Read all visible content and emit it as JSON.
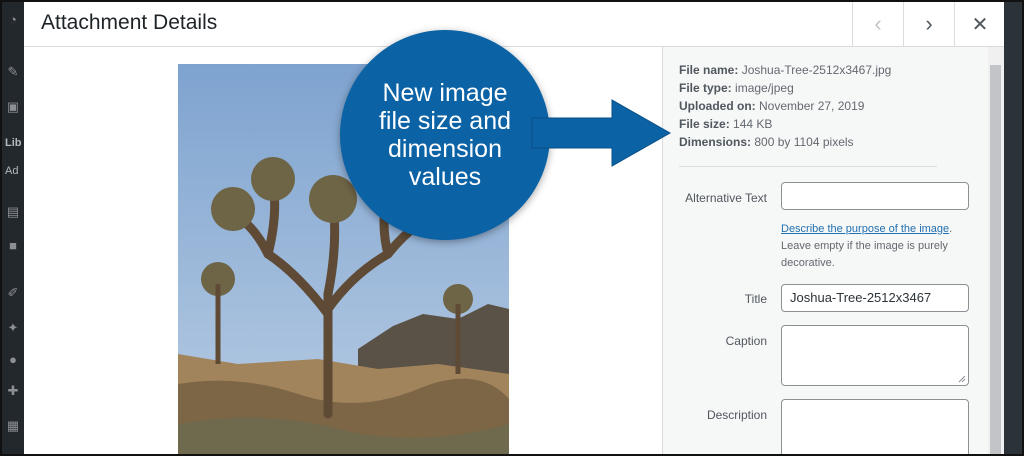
{
  "admin": {
    "lib_label": "Lib",
    "add_label": "Ad"
  },
  "header": {
    "title": "Attachment Details"
  },
  "file_info": {
    "name_label": "File name:",
    "name": "Joshua-Tree-2512x3467.jpg",
    "type_label": "File type:",
    "type": "image/jpeg",
    "uploaded_label": "Uploaded on:",
    "uploaded": "November 27, 2019",
    "size_label": "File size:",
    "size": "144 KB",
    "dimensions_label": "Dimensions:",
    "dimensions": "800 by 1104 pixels"
  },
  "fields": {
    "alt_label": "Alternative Text",
    "alt_value": "",
    "alt_help_link": "Describe the purpose of the image",
    "alt_help_text": "Leave empty if the image is purely decorative.",
    "title_label": "Title",
    "title_value": "Joshua-Tree-2512x3467",
    "caption_label": "Caption",
    "description_label": "Description"
  },
  "callout": {
    "line1": "New image",
    "line2": "file size and",
    "line3": "dimension",
    "line4": "values"
  },
  "colors": {
    "callout": "#0b62a4",
    "link": "#2271b1"
  }
}
